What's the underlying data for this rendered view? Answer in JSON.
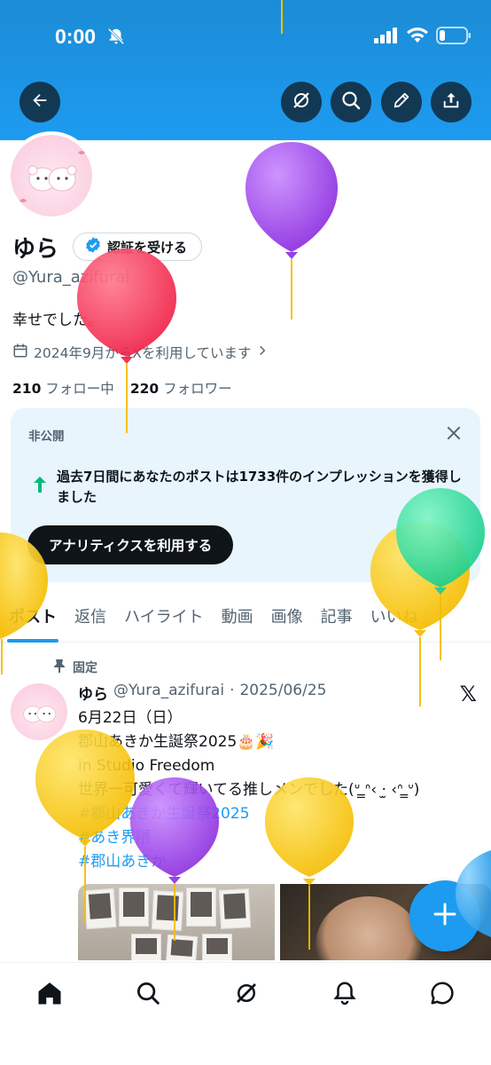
{
  "status_bar": {
    "time": "0:00",
    "battery_level": 0.2
  },
  "header": {
    "back_icon": "arrow-left-icon",
    "actions": [
      "grok-icon",
      "search-icon",
      "edit-icon",
      "share-icon"
    ]
  },
  "profile": {
    "display_name": "ゆら",
    "verify_button": "認証を受ける",
    "handle": "@Yura_azifurai",
    "bio": "幸せでした。",
    "joined": "2024年9月からXを利用しています",
    "following_count": "210",
    "following_label": "フォロー中",
    "followers_count": "220",
    "followers_label": "フォロワー"
  },
  "private_card": {
    "label": "非公開",
    "impression_text": "過去7日間にあなたのポストは1733件のインプレッションを獲得しました",
    "analytics_button": "アナリティクスを利用する"
  },
  "tabs": [
    "ポスト",
    "返信",
    "ハイライト",
    "動画",
    "画像",
    "記事",
    "いいね"
  ],
  "active_tab": "ポスト",
  "post": {
    "pinned_label": "固定",
    "author_name": "ゆら",
    "author_handle": "@Yura_azifurai",
    "separator": "·",
    "date": "2025/06/25",
    "lines": [
      "6月22日（日）",
      "郡山あきか生誕祭2025🎂🎉",
      "in Studio Freedom",
      "世界一可愛くて輝いてる推しメンでした(ᐡ ̳ᐢ‹ ‧̫ ‹ᐢ ̳ᐡ)"
    ],
    "hashtags": [
      "#郡山あきか生誕祭2025",
      "#あき界隈",
      "#郡山あきか"
    ]
  },
  "fab": {
    "label": "+"
  },
  "bottom_nav": [
    "home-icon",
    "search-icon",
    "grok-icon",
    "notifications-icon",
    "messages-icon"
  ],
  "colors": {
    "accent": "#1d9bf0",
    "text": "#0f1419",
    "secondary": "#536471",
    "card_bg": "#e8f5fd"
  }
}
